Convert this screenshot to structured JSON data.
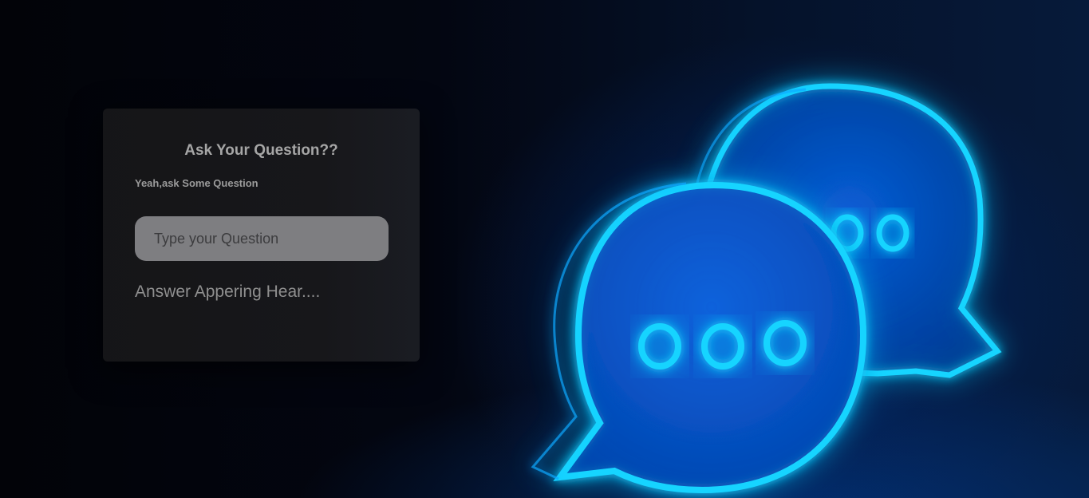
{
  "card": {
    "title": "Ask Your Question??",
    "subtitle": "Yeah,ask Some Question",
    "input_placeholder": "Type your Question",
    "answer_text": "Answer Appering Hear...."
  },
  "background": {
    "illustration": "neon-chat-bubbles-icon",
    "accent_color": "#00c8ff",
    "glow_color": "#0064ff"
  }
}
